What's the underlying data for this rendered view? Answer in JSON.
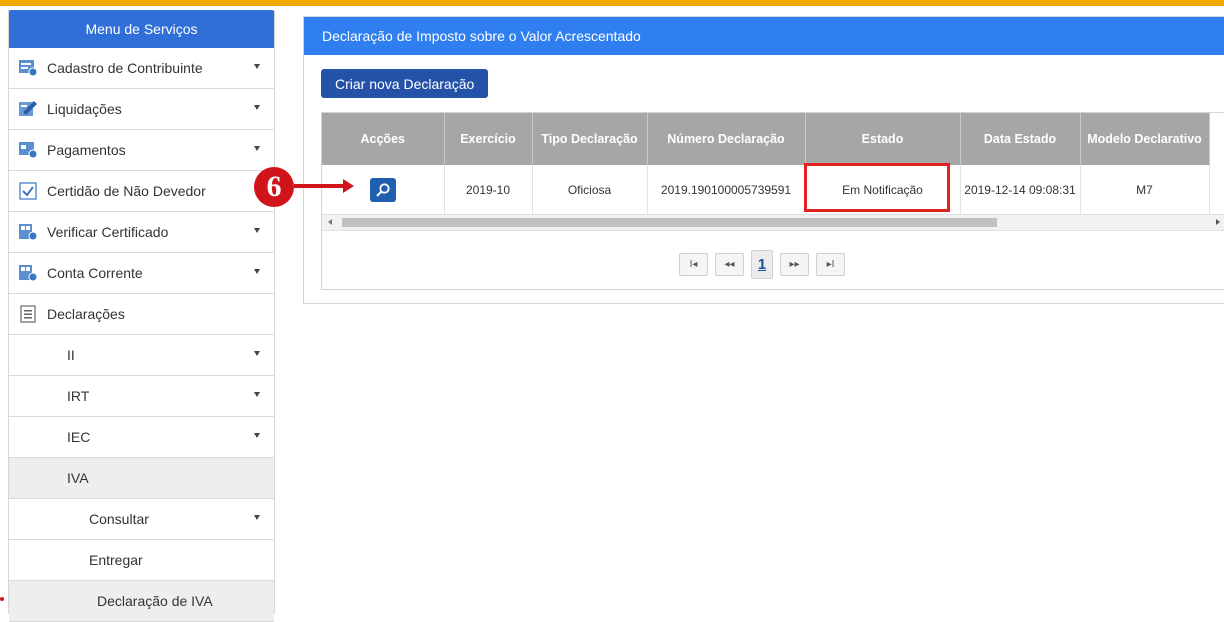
{
  "sidebar": {
    "title": "Menu de Serviços",
    "items": [
      {
        "label": "Cadastro de Contribuinte",
        "icon": "registry-icon"
      },
      {
        "label": "Liquidações",
        "icon": "liquidation-icon"
      },
      {
        "label": "Pagamentos",
        "icon": "payment-icon"
      },
      {
        "label": "Certidão de Não Devedor",
        "icon": "certificate-icon"
      },
      {
        "label": "Verificar Certificado",
        "icon": "verify-certificate-icon"
      },
      {
        "label": "Conta Corrente",
        "icon": "current-account-icon"
      },
      {
        "label": "Declarações",
        "icon": "declarations-icon"
      },
      {
        "label": "II"
      },
      {
        "label": "IRT"
      },
      {
        "label": "IEC"
      },
      {
        "label": "IVA"
      },
      {
        "label": "Consultar"
      },
      {
        "label": "Entregar"
      },
      {
        "label": "Declaração de IVA"
      }
    ]
  },
  "panel": {
    "title": "Declaração de Imposto sobre o Valor Acrescentado",
    "new_button": "Criar nova Declaração"
  },
  "table": {
    "headers": [
      "Acções",
      "Exercício",
      "Tipo Declaração",
      "Número Declaração",
      "Estado",
      "Data Estado",
      "Modelo Declarativo"
    ],
    "rows": [
      {
        "exercicio": "2019-10",
        "tipo": "Oficiosa",
        "numero": "2019.190100005739591",
        "estado": "Em Notificação",
        "data": "2019-12-14 09:08:31",
        "modelo": "M7"
      }
    ]
  },
  "pager": {
    "current": "1"
  },
  "annotation": {
    "step": "6"
  },
  "colors": {
    "accent_bar": "#f2a900",
    "header_blue": "#2f7ff0",
    "button_blue": "#2452a8",
    "highlight_red": "#e2221e"
  }
}
